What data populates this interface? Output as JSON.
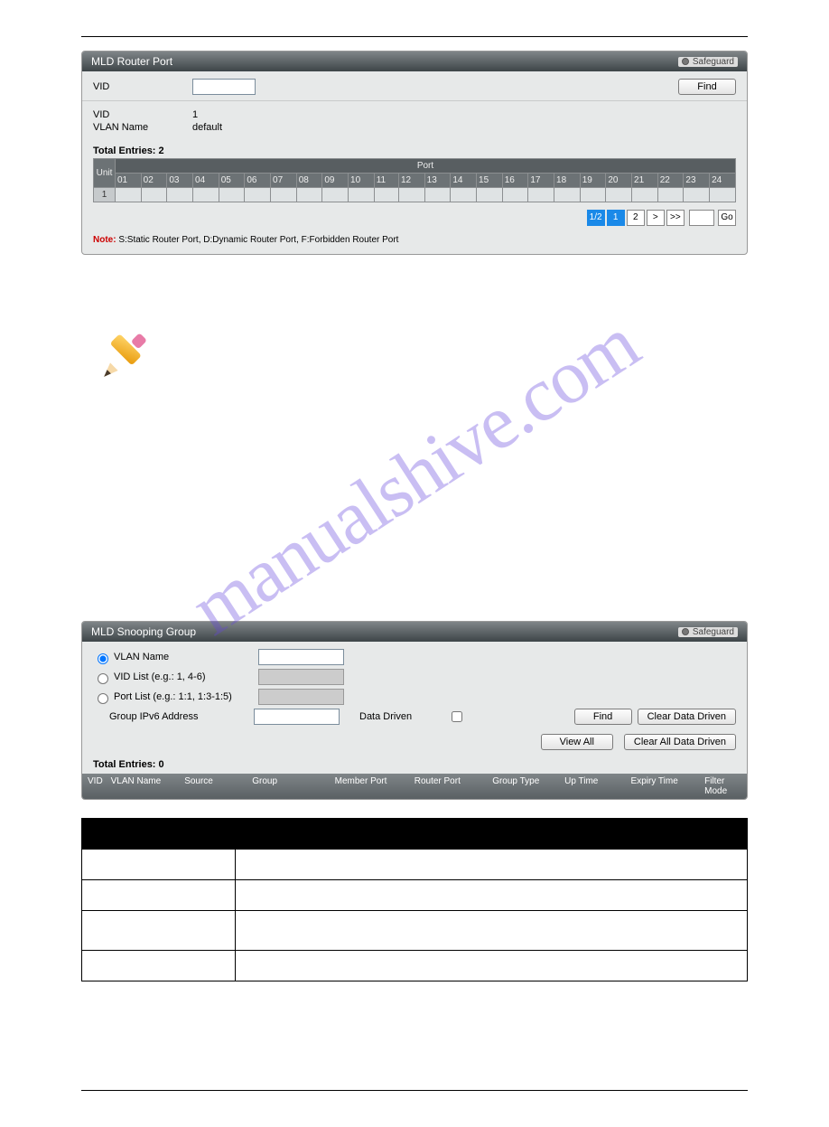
{
  "panel1": {
    "title": "MLD Router Port",
    "safeguard": "Safeguard",
    "vid_label": "VID",
    "find_button": "Find",
    "vid_label2": "VID",
    "vid_value": "1",
    "vlan_name_label": "VLAN Name",
    "vlan_name_value": "default",
    "total_label": "Total Entries: 2",
    "unit_header": "Unit",
    "port_header": "Port",
    "ports": [
      "01",
      "02",
      "03",
      "04",
      "05",
      "06",
      "07",
      "08",
      "09",
      "10",
      "11",
      "12",
      "13",
      "14",
      "15",
      "16",
      "17",
      "18",
      "19",
      "20",
      "21",
      "22",
      "23",
      "24"
    ],
    "unit_value": "1",
    "pager": {
      "range": "1/2",
      "p1": "1",
      "p2": "2",
      "next": ">",
      "last": ">>",
      "go": "Go"
    },
    "note_prefix": "Note:",
    "note_text": " S:Static Router Port, D:Dynamic Router Port, F:Forbidden Router Port"
  },
  "watermark": "manualshive.com",
  "panel2": {
    "title": "MLD Snooping Group",
    "safeguard": "Safeguard",
    "opt_vlan": "VLAN Name",
    "opt_vid_list": "VID List (e.g.: 1, 4-6)",
    "opt_port_list": "Port List (e.g.: 1:1, 1:3-1:5)",
    "group_ipv6_label": "Group IPv6 Address",
    "data_driven_label": "Data Driven",
    "find_button": "Find",
    "clear_dd_button": "Clear Data Driven",
    "view_all_button": "View All",
    "clear_all_dd_button": "Clear All Data Driven",
    "total_label": "Total Entries: 0",
    "cols": [
      "VID",
      "VLAN Name",
      "Source",
      "Group",
      "Member Port",
      "Router Port",
      "Group Type",
      "Up Time",
      "Expiry Time",
      "Filter Mode"
    ]
  },
  "table": {
    "rows": 5,
    "cols": 2
  }
}
